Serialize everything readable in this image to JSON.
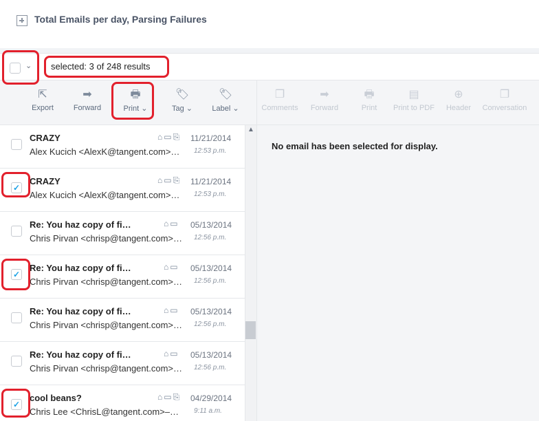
{
  "header": {
    "title": "Total Emails per day, Parsing Failures"
  },
  "selection": {
    "text": "selected: 3 of 248 results",
    "caret": "⌄"
  },
  "toolbar_left": [
    {
      "label": "Export",
      "icon": "export-icon",
      "glyph": "⇱"
    },
    {
      "label": "Forward",
      "icon": "forward-icon",
      "glyph": "➡"
    },
    {
      "label": "Print ⌄",
      "icon": "printer-icon",
      "glyph": "🖶"
    },
    {
      "label": "Tag ⌄",
      "icon": "tag-icon",
      "glyph": "🏷"
    },
    {
      "label": "Label ⌄",
      "icon": "label-icon",
      "glyph": "🏷"
    }
  ],
  "toolbar_right": [
    {
      "label": "Comments",
      "icon": "comments-icon",
      "glyph": "❐"
    },
    {
      "label": "Forward",
      "icon": "forward-icon",
      "glyph": "➡"
    },
    {
      "label": "Print",
      "icon": "printer-icon",
      "glyph": "🖶"
    },
    {
      "label": "Print to PDF",
      "icon": "pdf-icon",
      "glyph": "▤"
    },
    {
      "label": "Header",
      "icon": "zoom-icon",
      "glyph": "⊕"
    },
    {
      "label": "Conversation",
      "icon": "conversation-icon",
      "glyph": "❐"
    }
  ],
  "emails": [
    {
      "subject": "CRAZY",
      "from": "Alex Kucich <AlexK@tangent.com>…",
      "date": "11/21/2014",
      "time": "12:53 p.m.",
      "checked": false,
      "icons": "⌂▭⎘"
    },
    {
      "subject": "CRAZY",
      "from": "Alex Kucich <AlexK@tangent.com>…",
      "date": "11/21/2014",
      "time": "12:53 p.m.",
      "checked": true,
      "icons": "⌂▭⎘"
    },
    {
      "subject": "Re: You haz copy of fi…",
      "from": "Chris Pirvan <chrisp@tangent.com>…",
      "date": "05/13/2014",
      "time": "12:56 p.m.",
      "checked": false,
      "icons": "⌂▭"
    },
    {
      "subject": "Re: You haz copy of fi…",
      "from": "Chris Pirvan <chrisp@tangent.com>…",
      "date": "05/13/2014",
      "time": "12:56 p.m.",
      "checked": true,
      "icons": "⌂▭"
    },
    {
      "subject": "Re: You haz copy of fi…",
      "from": "Chris Pirvan <chrisp@tangent.com>…",
      "date": "05/13/2014",
      "time": "12:56 p.m.",
      "checked": false,
      "icons": "⌂▭"
    },
    {
      "subject": "Re: You haz copy of fi…",
      "from": "Chris Pirvan <chrisp@tangent.com>…",
      "date": "05/13/2014",
      "time": "12:56 p.m.",
      "checked": false,
      "icons": "⌂▭"
    },
    {
      "subject": "cool beans?",
      "from": "Chris Lee <ChrisL@tangent.com>–…",
      "date": "04/29/2014",
      "time": "9:11 a.m.",
      "checked": true,
      "icons": "⌂▭⎘"
    }
  ],
  "preview": {
    "message": "No email has been selected for display."
  },
  "colors": {
    "annotation": "#e2202c",
    "accent": "#1aa1e6"
  }
}
